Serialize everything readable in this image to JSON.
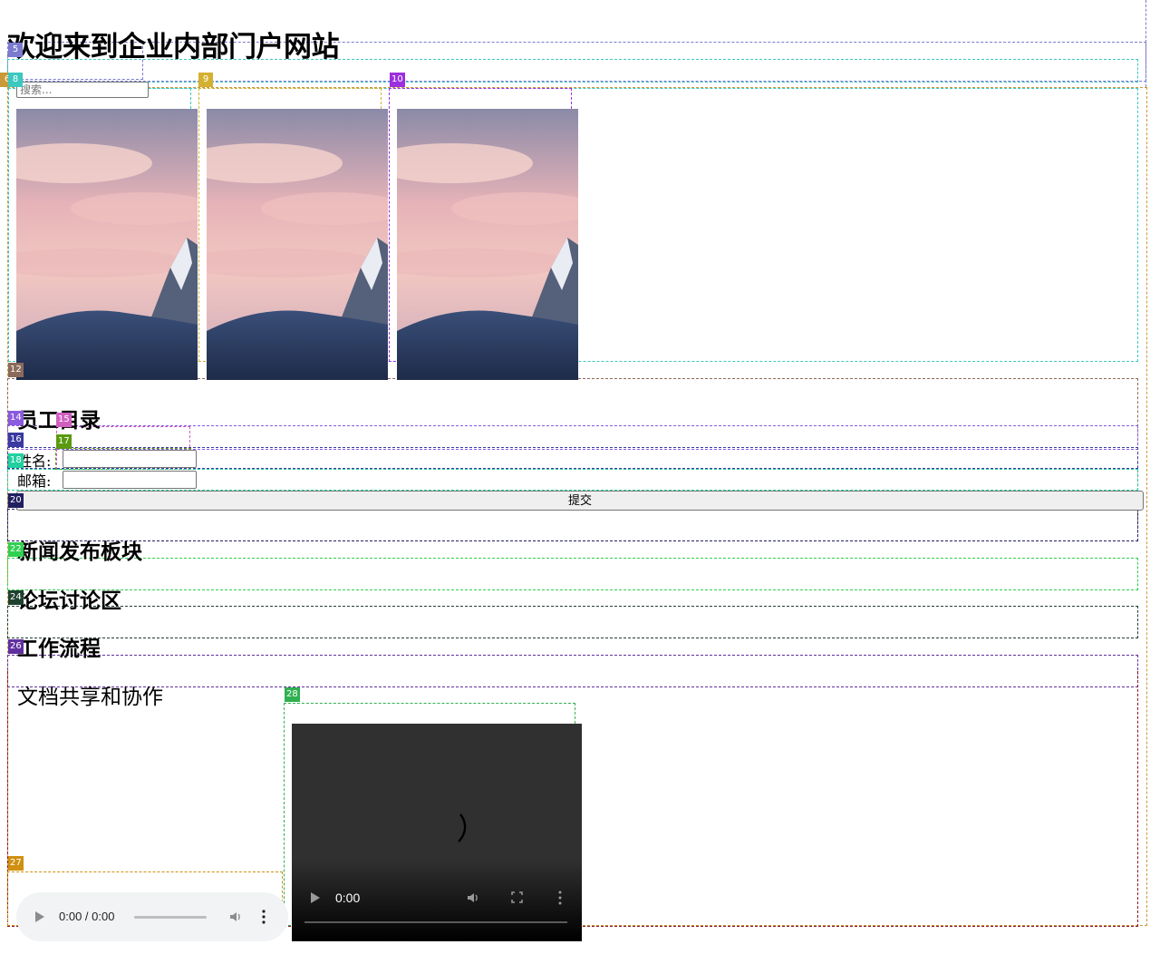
{
  "header": {
    "title": "欢迎来到企业内部门户网站"
  },
  "search": {
    "placeholder": "搜索..."
  },
  "gallery": {
    "image_count": 3,
    "image_subject": "snow mountain at sunset"
  },
  "employee_directory": {
    "heading": "员工目录",
    "name_label": "姓名:",
    "email_label": "邮箱:",
    "name_value": "",
    "email_value": "",
    "submit_label": "提交"
  },
  "sections": [
    {
      "heading": "新闻发布板块"
    },
    {
      "heading": "论坛讨论区"
    },
    {
      "heading": "工作流程"
    },
    {
      "heading": "文档共享和协作"
    }
  ],
  "audio_player": {
    "time_display": "0:00 / 0:00"
  },
  "video_player": {
    "time_display": "0:00"
  },
  "overlay_labels": [
    "5",
    "6",
    "8",
    "9",
    "10",
    "12",
    "14",
    "15",
    "16",
    "17",
    "18",
    "20",
    "22",
    "24",
    "26",
    "27",
    "28"
  ],
  "overlay_colors": {
    "5": "#7b7bd0",
    "6": "#c89a3a",
    "8": "#3cc8c0",
    "9": "#d4b030",
    "10": "#9b30e0",
    "12": "#8a6a5a",
    "14": "#8a5ae0",
    "15": "#d060c0",
    "16": "#3a3aa0",
    "17": "#5a9a10",
    "18": "#20d0a0",
    "20": "#202060",
    "22": "#30d050",
    "24": "#204030",
    "26": "#6030a0",
    "27": "#d09010",
    "28": "#30b050"
  }
}
